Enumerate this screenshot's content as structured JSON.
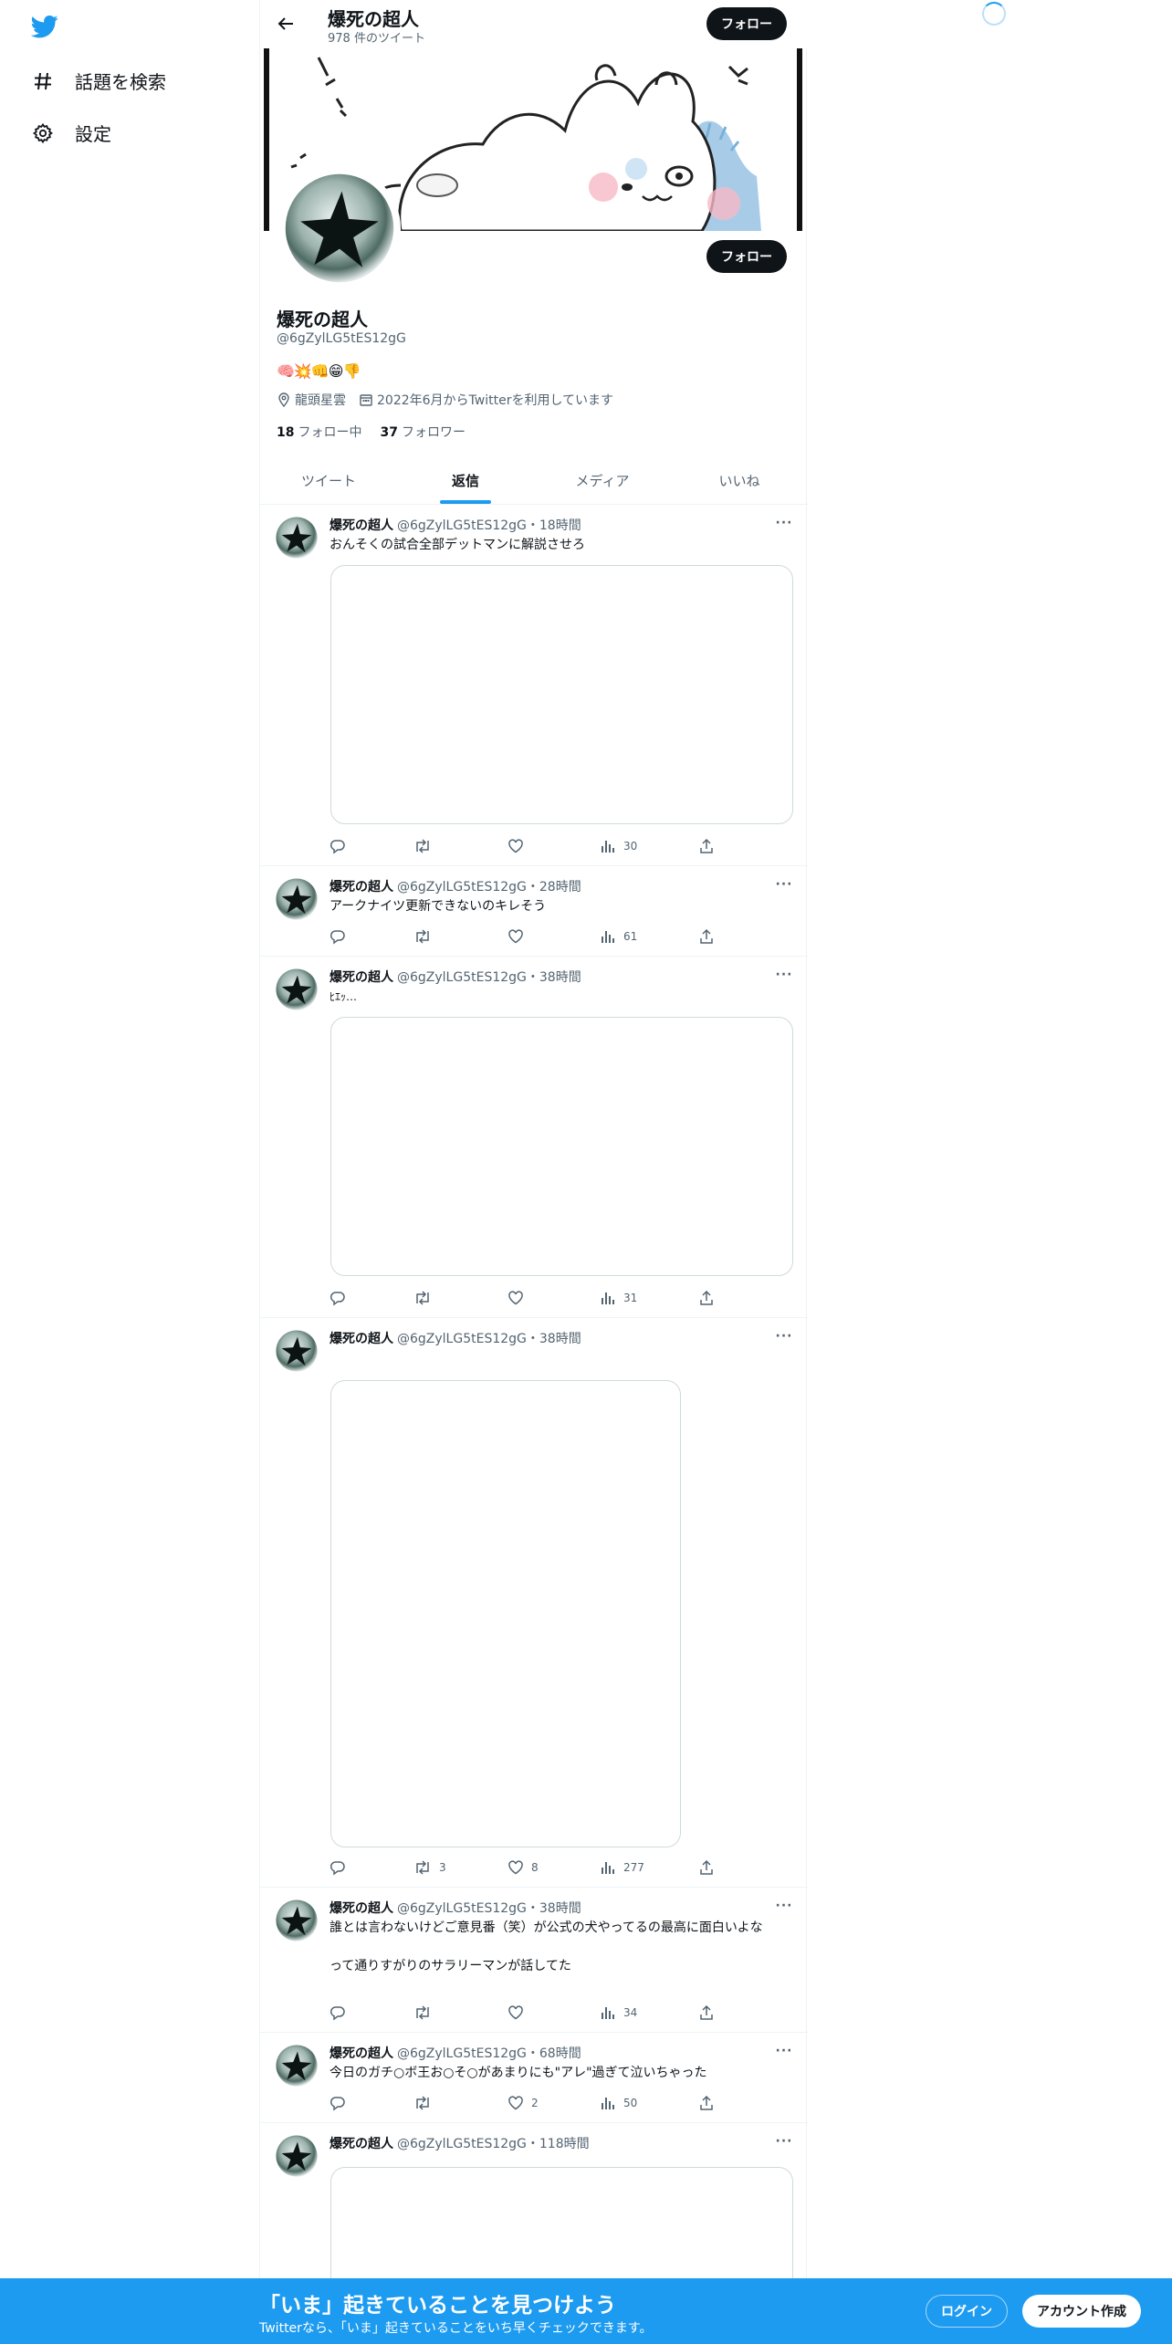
{
  "colors": {
    "accent": "#1d9bf0",
    "text": "#0f1419",
    "muted": "#536471",
    "border": "#eff3f4"
  },
  "sidebar": {
    "logo": "twitter-bird-icon",
    "items": [
      {
        "label": "話題を検索",
        "icon": "hashtag-icon"
      },
      {
        "label": "設定",
        "icon": "gear-icon"
      }
    ]
  },
  "header": {
    "title": "爆死の超人",
    "subtitle": "978 件のツイート",
    "follow_label": "フォロー"
  },
  "profile": {
    "name": "爆死の超人",
    "handle": "@6gZylLG5tES12gG",
    "bio": "🧠💥👊😁👎",
    "location": "龍頭星雲",
    "joined": "2022年6月からTwitterを利用しています",
    "following_count": "18",
    "following_label": "フォロー中",
    "followers_count": "37",
    "followers_label": "フォロワー",
    "follow_label": "フォロー"
  },
  "tabs": [
    {
      "label": "ツイート",
      "active": false
    },
    {
      "label": "返信",
      "active": true
    },
    {
      "label": "メディア",
      "active": false
    },
    {
      "label": "いいね",
      "active": false
    }
  ],
  "tweets": [
    {
      "name": "爆死の超人",
      "meta": "@6gZylLG5tES12gG・18時間",
      "text": "おんそくの試合全部デットマンに解説させろ",
      "retweets": "",
      "likes": "",
      "views": "30",
      "more": "···"
    },
    {
      "name": "爆死の超人",
      "meta": "@6gZylLG5tES12gG・28時間",
      "text": "アークナイツ更新できないのキレそう",
      "retweets": "",
      "likes": "",
      "views": "61",
      "more": "···"
    },
    {
      "name": "爆死の超人",
      "meta": "@6gZylLG5tES12gG・38時間",
      "text": "ﾋｴｯ…",
      "retweets": "",
      "likes": "",
      "views": "31",
      "more": "···"
    },
    {
      "name": "爆死の超人",
      "meta": "@6gZylLG5tES12gG・38時間",
      "text": "",
      "retweets": "3",
      "likes": "8",
      "views": "277",
      "more": "···"
    },
    {
      "name": "爆死の超人",
      "meta": "@6gZylLG5tES12gG・38時間",
      "text": "誰とは言わないけどご意見番（笑）が公式の犬やってるの最高に面白いよな\n\nって通りすがりのサラリーマンが話してた",
      "retweets": "",
      "likes": "",
      "views": "34",
      "more": "···"
    },
    {
      "name": "爆死の超人",
      "meta": "@6gZylLG5tES12gG・68時間",
      "text": "今日のガチ○ボ王お○そ○があまりにも\"アレ\"過ぎて泣いちゃった",
      "retweets": "",
      "likes": "2",
      "views": "50",
      "more": "···"
    },
    {
      "name": "爆死の超人",
      "meta": "@6gZylLG5tES12gG・118時間",
      "text": "",
      "retweets": "",
      "likes": "",
      "views": "",
      "more": "···"
    }
  ],
  "bottom_bar": {
    "title": "「いま」起きていることを見つけよう",
    "subtitle": "Twitterなら、「いま」起きていることをいち早くチェックできます。",
    "login_label": "ログイン",
    "signup_label": "アカウント作成"
  }
}
